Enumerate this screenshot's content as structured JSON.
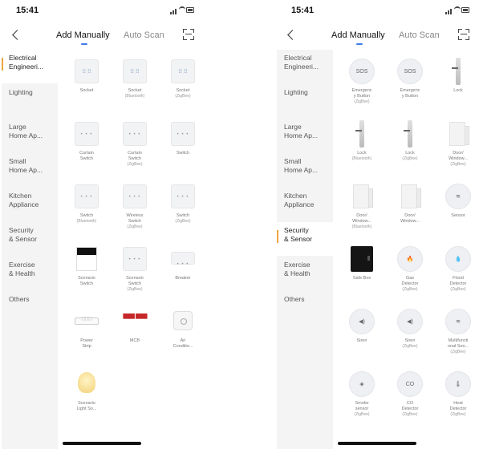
{
  "screens": [
    {
      "status_time": "15:41",
      "tabs": {
        "manual": "Add Manually",
        "auto": "Auto Scan"
      },
      "categories": [
        "Electrical\nEngineeri...",
        "Lighting",
        "Large\nHome Ap...",
        "Small\nHome Ap...",
        "Kitchen\nAppliance",
        "Security\n& Sensor",
        "Exercise\n& Health",
        "Others"
      ],
      "active_category_index": 0,
      "devices": [
        {
          "icon": "socket-icon",
          "label": "Socket",
          "sub": ""
        },
        {
          "icon": "socket-bluetooth-icon",
          "label": "Socket",
          "sub": "(Bluetooth)"
        },
        {
          "icon": "socket-zigbee-icon",
          "label": "Socket",
          "sub": "(ZigBee)"
        },
        {
          "icon": "curtain-switch-icon",
          "label": "Curtain\nSwitch",
          "sub": ""
        },
        {
          "icon": "curtain-switch-zigbee-icon",
          "label": "Curtain\nSwitch",
          "sub": "(ZigBee)"
        },
        {
          "icon": "switch-icon",
          "label": "Switch",
          "sub": ""
        },
        {
          "icon": "switch-bluetooth-icon",
          "label": "Switch",
          "sub": "(Bluetooth)"
        },
        {
          "icon": "wireless-switch-icon",
          "label": "Wireless\nSwitch",
          "sub": "(ZigBee)"
        },
        {
          "icon": "switch-zigbee-icon",
          "label": "Switch",
          "sub": "(ZigBee)"
        },
        {
          "icon": "scenario-switch-icon",
          "label": "Scenario\nSwitch",
          "sub": ""
        },
        {
          "icon": "scenario-switch-zigbee-icon",
          "label": "Scenario\nSwitch",
          "sub": "(ZigBee)"
        },
        {
          "icon": "breaker-icon",
          "label": "Breaker",
          "sub": ""
        },
        {
          "icon": "power-strip-icon",
          "label": "Power\nStrip",
          "sub": ""
        },
        {
          "icon": "mcb-icon",
          "label": "MCB",
          "sub": ""
        },
        {
          "icon": "air-conditioner-icon",
          "label": "Air\nConditio...",
          "sub": ""
        },
        {
          "icon": "scenario-light-icon",
          "label": "Scenario\nLight So...",
          "sub": ""
        }
      ]
    },
    {
      "status_time": "15:41",
      "tabs": {
        "manual": "Add Manually",
        "auto": "Auto Scan"
      },
      "categories": [
        "Electrical\nEngineeri...",
        "Lighting",
        "Large\nHome Ap...",
        "Small\nHome Ap...",
        "Kitchen\nAppliance",
        "Security\n& Sensor",
        "Exercise\n& Health",
        "Others"
      ],
      "active_category_index": 5,
      "devices": [
        {
          "icon": "sos-icon",
          "glyph": "SOS",
          "label": "Emergenc\ny Button",
          "sub": "(ZigBee)"
        },
        {
          "icon": "sos-icon",
          "glyph": "SOS",
          "label": "Emergenc\ny Button",
          "sub": ""
        },
        {
          "icon": "lock-icon",
          "label": "Lock",
          "sub": ""
        },
        {
          "icon": "lock-icon",
          "label": "Lock",
          "sub": "(Bluetooth)"
        },
        {
          "icon": "lock-icon",
          "label": "Lock",
          "sub": "(ZigBee)"
        },
        {
          "icon": "door-window-sensor-icon",
          "label": "Door/\nWindow...",
          "sub": "(ZigBee)"
        },
        {
          "icon": "door-window-sensor-icon",
          "label": "Door/\nWindow...",
          "sub": "(Bluetooth)"
        },
        {
          "icon": "door-window-sensor-icon",
          "label": "Door/\nWindow...",
          "sub": ""
        },
        {
          "icon": "sensor-icon",
          "glyph": "≋",
          "label": "Sensor",
          "sub": ""
        },
        {
          "icon": "safe-box-icon",
          "label": "Safe Box",
          "sub": ""
        },
        {
          "icon": "gas-detector-icon",
          "glyph": "🔥",
          "label": "Gas\nDetector",
          "sub": "(ZigBee)"
        },
        {
          "icon": "flood-detector-icon",
          "glyph": "💧",
          "label": "Flood\nDetector",
          "sub": "(ZigBee)"
        },
        {
          "icon": "siren-icon",
          "glyph": "◀)",
          "label": "Siren",
          "sub": ""
        },
        {
          "icon": "siren-icon",
          "glyph": "◀)",
          "label": "Siren",
          "sub": "(ZigBee)"
        },
        {
          "icon": "multifunctional-sensor-icon",
          "glyph": "≋",
          "label": "Multifuncti\nonal Sen...",
          "sub": "(ZigBee)"
        },
        {
          "icon": "smoke-sensor-icon",
          "glyph": "◈",
          "label": "Smoke\nsensor",
          "sub": "(ZigBee)"
        },
        {
          "icon": "co-detector-icon",
          "glyph": "CO",
          "label": "CO\nDetector",
          "sub": "(ZigBee)"
        },
        {
          "icon": "heat-detector-icon",
          "glyph": "🌡",
          "label": "Heat\nDetector",
          "sub": "(ZigBee)"
        }
      ]
    }
  ],
  "colors": {
    "accent": "#3b7be8",
    "active_marker": "#f0a540",
    "sidebar_bg": "#f4f4f4"
  }
}
